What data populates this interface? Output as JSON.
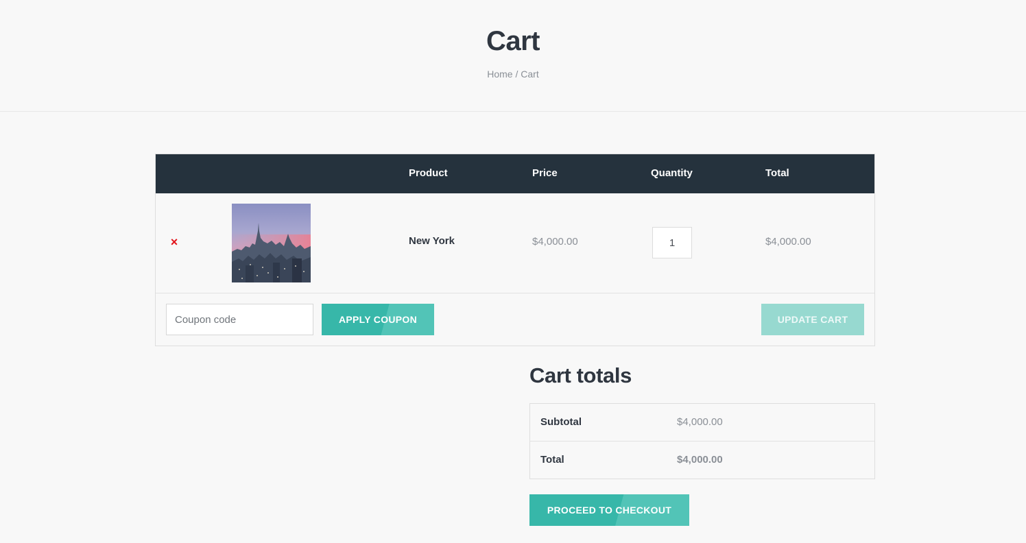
{
  "header": {
    "title": "Cart",
    "breadcrumb": {
      "home": "Home",
      "separator": " / ",
      "current": "Cart"
    }
  },
  "cart": {
    "columns": {
      "product": "Product",
      "price": "Price",
      "quantity": "Quantity",
      "total": "Total"
    },
    "items": [
      {
        "remove_icon": "×",
        "image": "new-york-skyline-thumbnail",
        "name": "New York",
        "price": "$4,000.00",
        "quantity": "1",
        "total": "$4,000.00"
      }
    ],
    "coupon_placeholder": "Coupon code",
    "apply_coupon_label": "APPLY COUPON",
    "update_cart_label": "UPDATE CART"
  },
  "totals": {
    "title": "Cart totals",
    "subtotal_label": "Subtotal",
    "subtotal_value": "$4,000.00",
    "total_label": "Total",
    "total_value": "$4,000.00",
    "checkout_label": "PROCEED TO CHECKOUT"
  },
  "colors": {
    "accent": "#37b7a9",
    "table_header": "#25323d",
    "remove": "#e2141b"
  }
}
